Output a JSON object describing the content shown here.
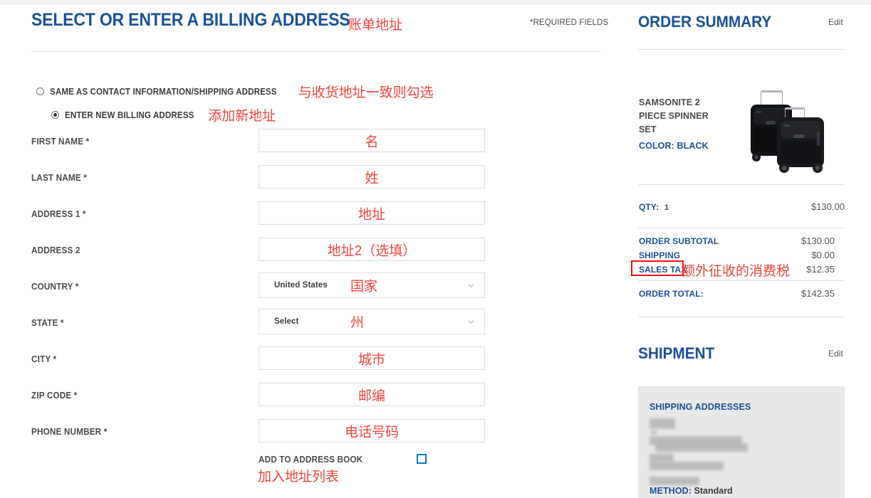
{
  "colors": {
    "brand_blue": "#1b5197",
    "annotation_red": "#f1453d",
    "highlight_red": "#ee1111",
    "label_gray": "#4b4b4b",
    "panel_gray": "#e8e8e8"
  },
  "billing": {
    "title": "SELECT OR ENTER A BILLING ADDRESS",
    "title_annotation": "账单地址",
    "required_note": "*REQUIRED FIELDS",
    "options": [
      {
        "label": "SAME AS CONTACT INFORMATION/SHIPPING ADDRESS",
        "annotation": "与收货地址一致则勾选",
        "selected": false
      },
      {
        "label": "ENTER NEW BILLING ADDRESS",
        "annotation": "添加新地址",
        "selected": true
      }
    ],
    "fields": [
      {
        "label": "FIRST NAME *",
        "type": "text",
        "value": "",
        "annotation": "名"
      },
      {
        "label": "LAST NAME *",
        "type": "text",
        "value": "",
        "annotation": "姓"
      },
      {
        "label": "ADDRESS 1 *",
        "type": "text",
        "value": "",
        "annotation": "地址"
      },
      {
        "label": "ADDRESS 2",
        "type": "text",
        "value": "",
        "annotation": "地址2（选填）"
      },
      {
        "label": "COUNTRY *",
        "type": "select",
        "value": "United States",
        "annotation": "国家"
      },
      {
        "label": "STATE *",
        "type": "select",
        "value": "Select",
        "annotation": "州"
      },
      {
        "label": "CITY *",
        "type": "text",
        "value": "",
        "annotation": "城市"
      },
      {
        "label": "ZIP CODE *",
        "type": "text",
        "value": "",
        "annotation": "邮编"
      },
      {
        "label": "PHONE NUMBER *",
        "type": "text",
        "value": "",
        "annotation": "电话号码"
      }
    ],
    "address_book": {
      "label": "ADD TO ADDRESS BOOK",
      "annotation": "加入地址列表",
      "checked": false
    }
  },
  "order_summary": {
    "title": "ORDER SUMMARY",
    "edit_label": "Edit",
    "product": {
      "name": "SAMSONITE 2 PIECE SPINNER SET",
      "color_label": "COLOR: BLACK",
      "image_alt": "black-spinner-luggage-set"
    },
    "qty_label": "QTY:",
    "qty_value": "1",
    "qty_price": "$130.00",
    "totals": [
      {
        "label": "ORDER SUBTOTAL",
        "value": "$130.00"
      },
      {
        "label": "SHIPPING",
        "value": "$0.00"
      },
      {
        "label": "SALES TAX",
        "value": "$12.35",
        "highlighted": true,
        "annotation": "额外征收的消费税"
      }
    ],
    "order_total": {
      "label": "ORDER TOTAL:",
      "value": "$142.35"
    }
  },
  "shipment": {
    "title": "SHIPMENT",
    "edit_label": "Edit",
    "addresses_title": "SHIPPING ADDRESSES",
    "address_redacted": true,
    "method_key": "METHOD:",
    "method_value": "Standard"
  }
}
